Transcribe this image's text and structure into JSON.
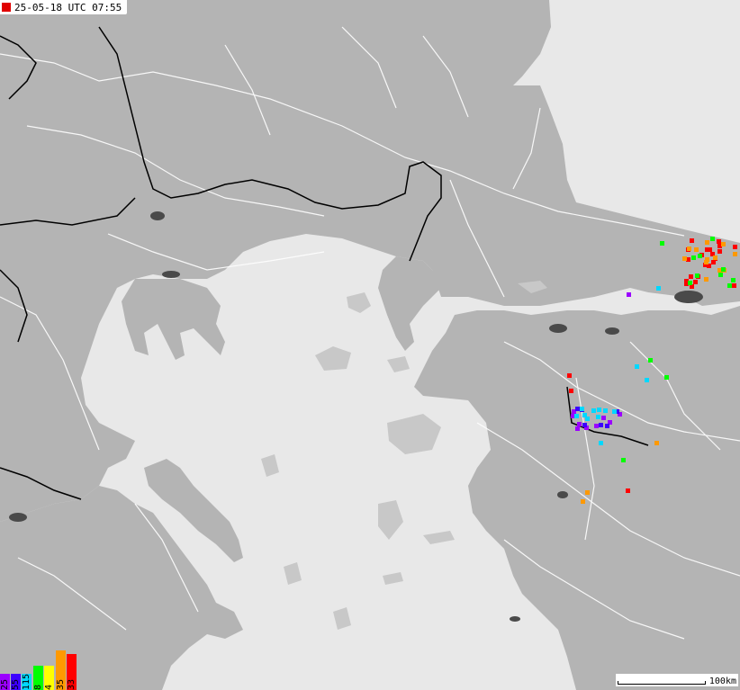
{
  "timestamp": {
    "label": "25-05-18 UTC 07:55",
    "indicator_color": "#e00000"
  },
  "legend": [
    {
      "label": "25",
      "color": "#9b00ff",
      "level": 0.42
    },
    {
      "label": "55",
      "color": "#3c00ff",
      "level": 0.42
    },
    {
      "label": "115",
      "color": "#00d8ff",
      "level": 0.42
    },
    {
      "label": "8",
      "color": "#00ff00",
      "level": 0.62
    },
    {
      "label": "4",
      "color": "#ffff00",
      "level": 0.62
    },
    {
      "label": "35",
      "color": "#ff9900",
      "level": 1.0
    },
    {
      "label": "33",
      "color": "#ff0000",
      "level": 0.92
    }
  ],
  "scalebar": {
    "label": "100km"
  },
  "colors": {
    "sea": "#e8e8e8",
    "land": "#b4b4b4",
    "land_dark": "#989898",
    "border": "#000000",
    "road": "#ffffff"
  },
  "strikes": [
    {
      "color": "#ff0000",
      "count": 24,
      "region": "east-coast"
    },
    {
      "color": "#ff9900",
      "count": 12,
      "region": "east-coast"
    },
    {
      "color": "#00ff00",
      "count": 8,
      "region": "east-coast"
    },
    {
      "color": "#9b00ff",
      "count": 10,
      "region": "inland-south"
    },
    {
      "color": "#3c00ff",
      "count": 6,
      "region": "inland-south"
    },
    {
      "color": "#00d8ff",
      "count": 9,
      "region": "inland-south"
    }
  ]
}
